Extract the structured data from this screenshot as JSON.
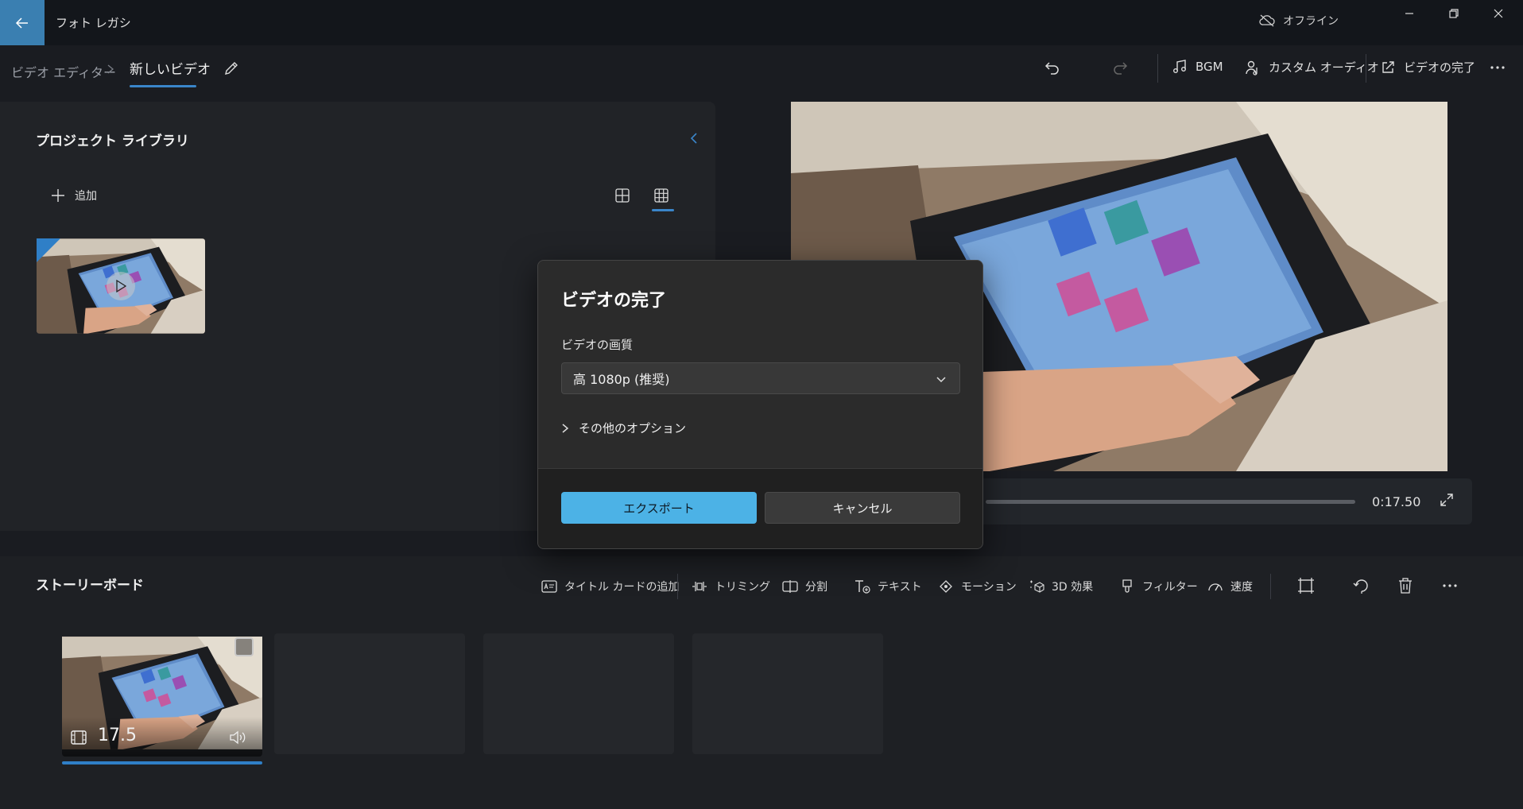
{
  "titlebar": {
    "app_title": "フォト レガシ",
    "offline_label": "オフライン"
  },
  "breadcrumb": {
    "editor": "ビデオ エディター",
    "current": "新しいビデオ"
  },
  "toolbar": {
    "bgm_label": "BGM",
    "custom_audio_label": "カスタム オーディオ",
    "finish_video_label": "ビデオの完了"
  },
  "library": {
    "title": "プロジェクト ライブラリ",
    "add_label": "追加"
  },
  "player": {
    "total_time": "0:17.50"
  },
  "storyboard": {
    "title": "ストーリーボード",
    "actions": {
      "add_title_card": "タイトル カードの追加",
      "trim": "トリミング",
      "split": "分割",
      "text": "テキスト",
      "motion": "モーション",
      "effects_3d": "3D 効果",
      "filters": "フィルター",
      "speed": "速度"
    },
    "clip": {
      "duration": "17.5"
    }
  },
  "dialog": {
    "title": "ビデオの完了",
    "quality_label": "ビデオの画質",
    "quality_value": "高 1080p (推奨)",
    "more_options": "その他のオプション",
    "export_label": "エクスポート",
    "cancel_label": "キャンセル"
  },
  "colors": {
    "accent": "#3a85c9",
    "export_button": "#4cb2e6",
    "back_button": "#3a7fb1"
  }
}
